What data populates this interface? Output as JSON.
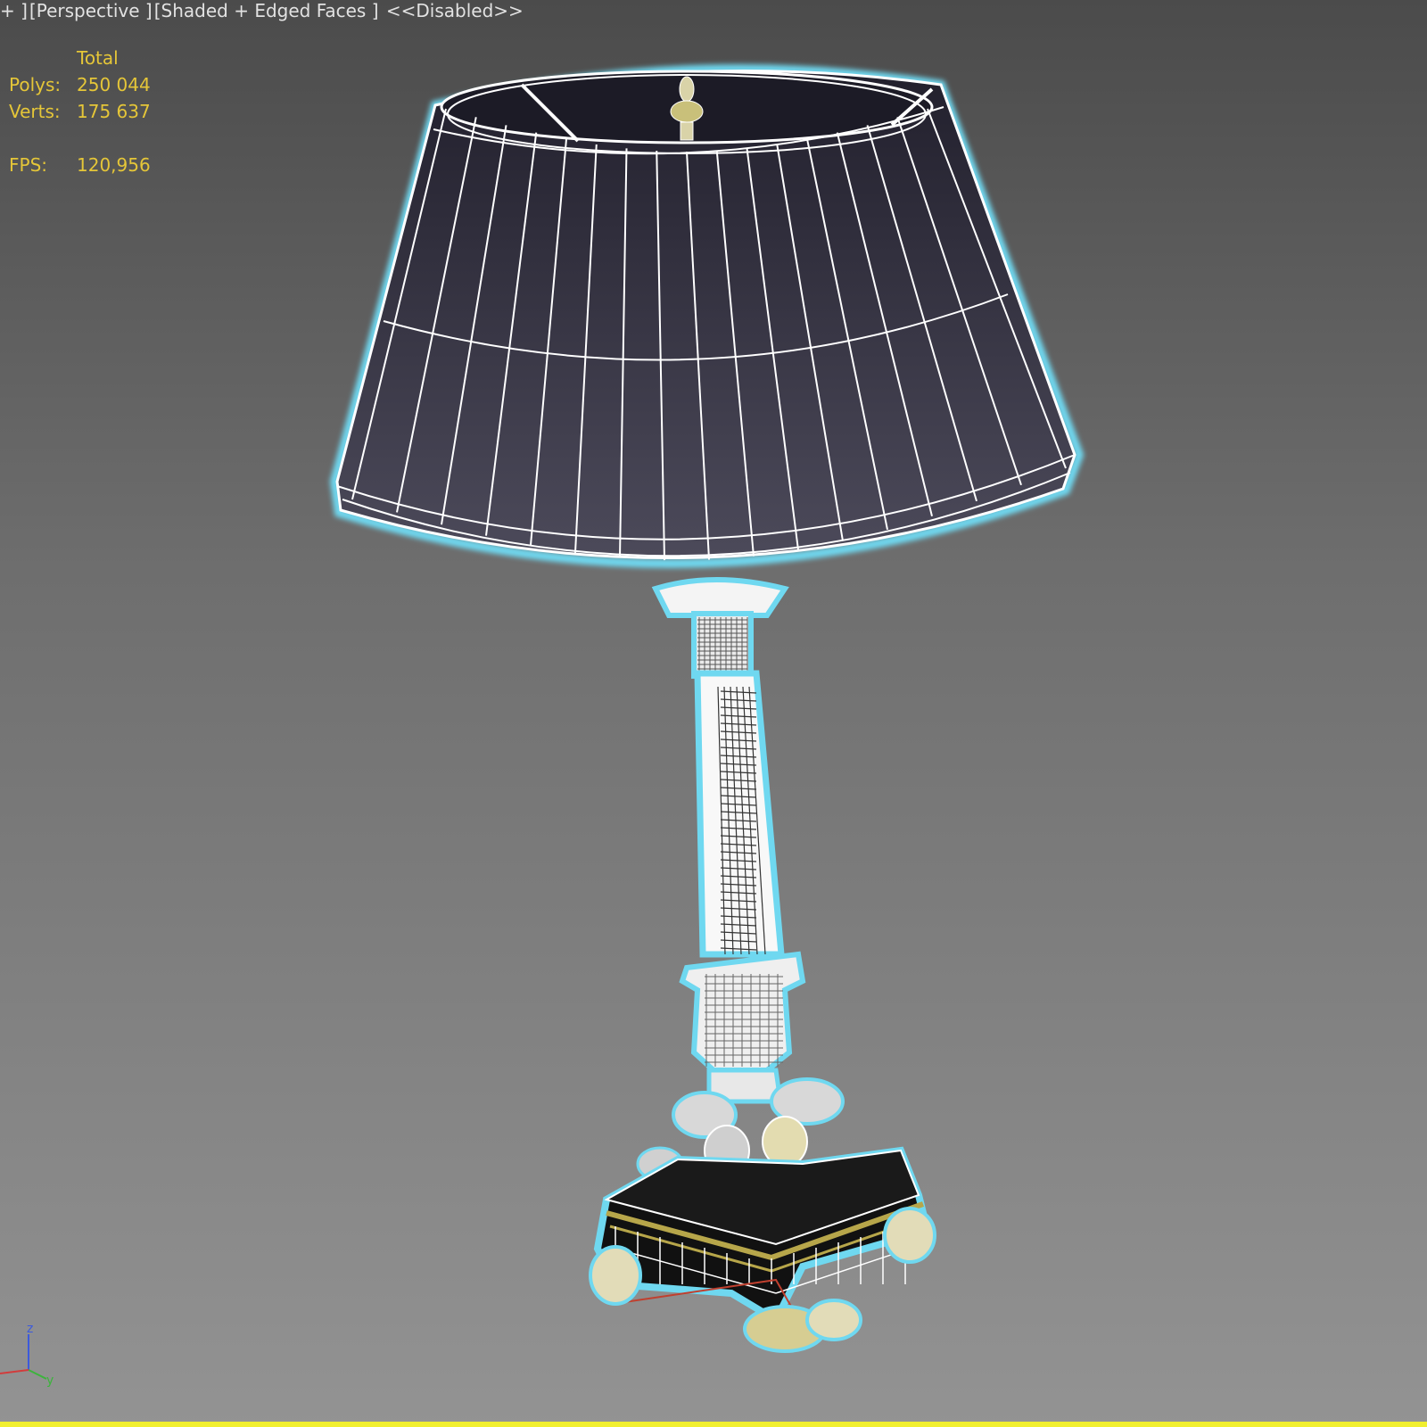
{
  "viewport": {
    "label_parts": [
      "+ ]",
      "[Perspective ]",
      "[Shaded + Edged Faces ]",
      " <<Disabled>>"
    ]
  },
  "stats": {
    "header": "Total",
    "rows": [
      {
        "label": "Polys:",
        "value": "250 044"
      },
      {
        "label": "Verts:",
        "value": "175 637"
      },
      {
        "label": "FPS:",
        "value": "120,956"
      }
    ]
  },
  "gizmo": {
    "z": "z",
    "y": "y"
  },
  "colors": {
    "stats_text": "#e5c638",
    "selection_outline": "#6fd8f0",
    "wire": "#ffffff",
    "shade_fill": "#3a3848",
    "timebar": "#f1ef2f"
  }
}
